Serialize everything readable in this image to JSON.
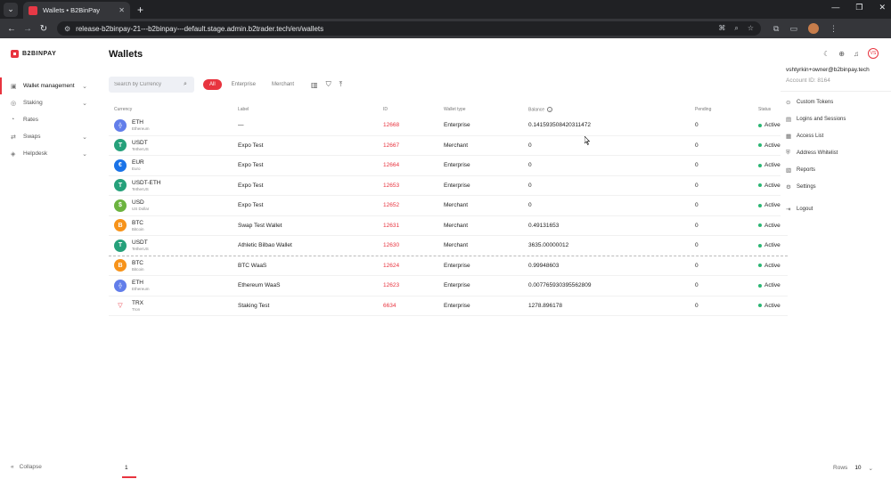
{
  "browser": {
    "tab_title": "Wallets • B2BinPay",
    "url": "release-b2binpay-21---b2binpay---default.stage.admin.b2trader.tech/en/wallets"
  },
  "app": {
    "logo_text": "B2BINPAY",
    "page_title": "Wallets",
    "avatar_initials": "VS"
  },
  "sidebar": {
    "items": [
      {
        "label": "Wallet management",
        "icon": "wallet-icon",
        "active": true
      },
      {
        "label": "Staking",
        "icon": "staking-icon"
      },
      {
        "label": "Rates",
        "icon": "rates-icon"
      },
      {
        "label": "Swaps",
        "icon": "swaps-icon"
      },
      {
        "label": "Helpdesk",
        "icon": "helpdesk-icon"
      }
    ],
    "collapse_label": "Collapse"
  },
  "filters": {
    "search_placeholder": "Search by Currency",
    "chips": [
      "All",
      "Enterprise",
      "Merchant"
    ]
  },
  "table": {
    "headers": [
      "Currency",
      "Label",
      "ID",
      "Wallet type",
      "Balance",
      "Pending",
      "Status"
    ],
    "rows": [
      {
        "sym": "ETH",
        "name": "Ethereum",
        "label": "—",
        "id": "12668",
        "type": "Enterprise",
        "balance": "0.141593508420311472",
        "pending": "0",
        "status": "Active"
      },
      {
        "sym": "USDT",
        "name": "TetherUS",
        "label": "Expo Test",
        "id": "12667",
        "type": "Merchant",
        "balance": "0",
        "pending": "0",
        "status": "Active"
      },
      {
        "sym": "EUR",
        "name": "Euro",
        "label": "Expo Test",
        "id": "12664",
        "type": "Enterprise",
        "balance": "0",
        "pending": "0",
        "status": "Active"
      },
      {
        "sym": "USDT-ETH",
        "name": "TetherUS",
        "label": "Expo Test",
        "id": "12653",
        "type": "Enterprise",
        "balance": "0",
        "pending": "0",
        "status": "Active"
      },
      {
        "sym": "USD",
        "name": "US Dollar",
        "label": "Expo Test",
        "id": "12652",
        "type": "Merchant",
        "balance": "0",
        "pending": "0",
        "status": "Active"
      },
      {
        "sym": "BTC",
        "name": "Bitcoin",
        "label": "Swap Test Wallet",
        "id": "12631",
        "type": "Merchant",
        "balance": "0.49131653",
        "pending": "0",
        "status": "Active"
      },
      {
        "sym": "USDT",
        "name": "TetherUS",
        "label": "Athletic Bilbao Wallet",
        "id": "12630",
        "type": "Merchant",
        "balance": "3635.00000012",
        "pending": "0",
        "status": "Active"
      },
      {
        "sym": "BTC",
        "name": "Bitcoin",
        "label": "BTC WaaS",
        "id": "12624",
        "type": "Enterprise",
        "balance": "0.99948603",
        "pending": "0",
        "status": "Active"
      },
      {
        "sym": "ETH",
        "name": "Ethereum",
        "label": "Ethereum WaaS",
        "id": "12623",
        "type": "Enterprise",
        "balance": "0.007765930395562809",
        "pending": "0",
        "status": "Active"
      },
      {
        "sym": "TRX",
        "name": "Tron",
        "label": "Staking Test",
        "id": "6634",
        "type": "Enterprise",
        "balance": "1278.896178",
        "pending": "0",
        "status": "Active"
      }
    ]
  },
  "user_menu": {
    "email": "vshtyrkin+owner@b2binpay.tech",
    "account": "Account ID: 8164",
    "items": [
      {
        "label": "Custom Tokens",
        "icon": "tokens-icon"
      },
      {
        "label": "Logins and Sessions",
        "icon": "sessions-icon"
      },
      {
        "label": "Access List",
        "icon": "access-list-icon"
      },
      {
        "label": "Address Whitelist",
        "icon": "whitelist-icon"
      },
      {
        "label": "Reports",
        "icon": "reports-icon"
      },
      {
        "label": "Settings",
        "icon": "settings-icon"
      },
      {
        "label": "Logout",
        "icon": "logout-icon"
      }
    ]
  },
  "pagination": {
    "page": "1",
    "rows_label": "Rows",
    "rows_value": "10"
  },
  "colors": {
    "accent": "#e8343f",
    "status_active": "#2bb673"
  }
}
